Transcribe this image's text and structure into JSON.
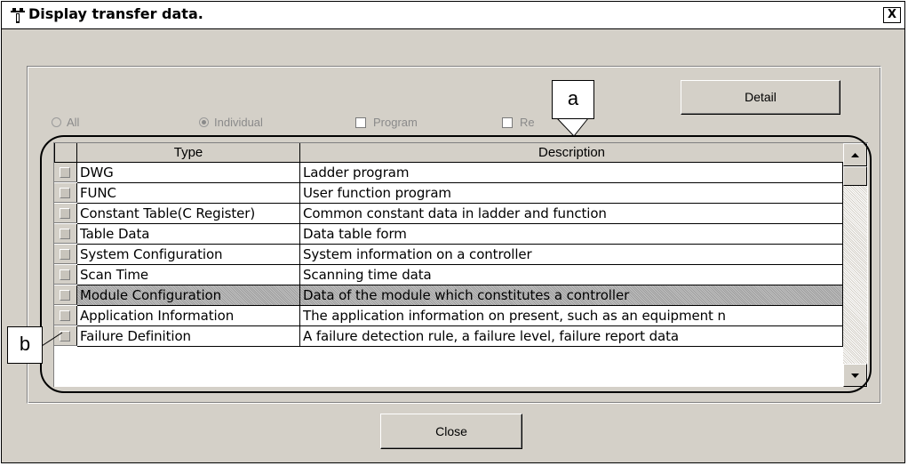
{
  "window": {
    "title": "Display transfer data.",
    "close_glyph": "X",
    "title_icon": "transfer-icon"
  },
  "options": {
    "all_label": "All",
    "individual_label": "Individual",
    "program_label": "Program",
    "re_label": "Re",
    "selected": "Individual"
  },
  "buttons": {
    "detail": "Detail",
    "close": "Close"
  },
  "table": {
    "headers": [
      "Type",
      "Description"
    ],
    "rows": [
      {
        "type": "DWG",
        "description": "Ladder program"
      },
      {
        "type": "FUNC",
        "description": "User function program"
      },
      {
        "type": "Constant Table(C Register)",
        "description": "Common constant data in ladder and function"
      },
      {
        "type": "Table Data",
        "description": "Data table form"
      },
      {
        "type": "System Configuration",
        "description": "System information on a controller"
      },
      {
        "type": "Scan Time",
        "description": "Scanning time data"
      },
      {
        "type": "Module Configuration",
        "description": "Data of the module which constitutes a controller"
      },
      {
        "type": "Application Information",
        "description": "The application information on present, such as an equipment n"
      },
      {
        "type": "Failure Definition",
        "description": "A failure detection rule, a failure level, failure report data"
      }
    ],
    "highlighted_row": 6
  },
  "callouts": {
    "a": "a",
    "b": "b"
  }
}
